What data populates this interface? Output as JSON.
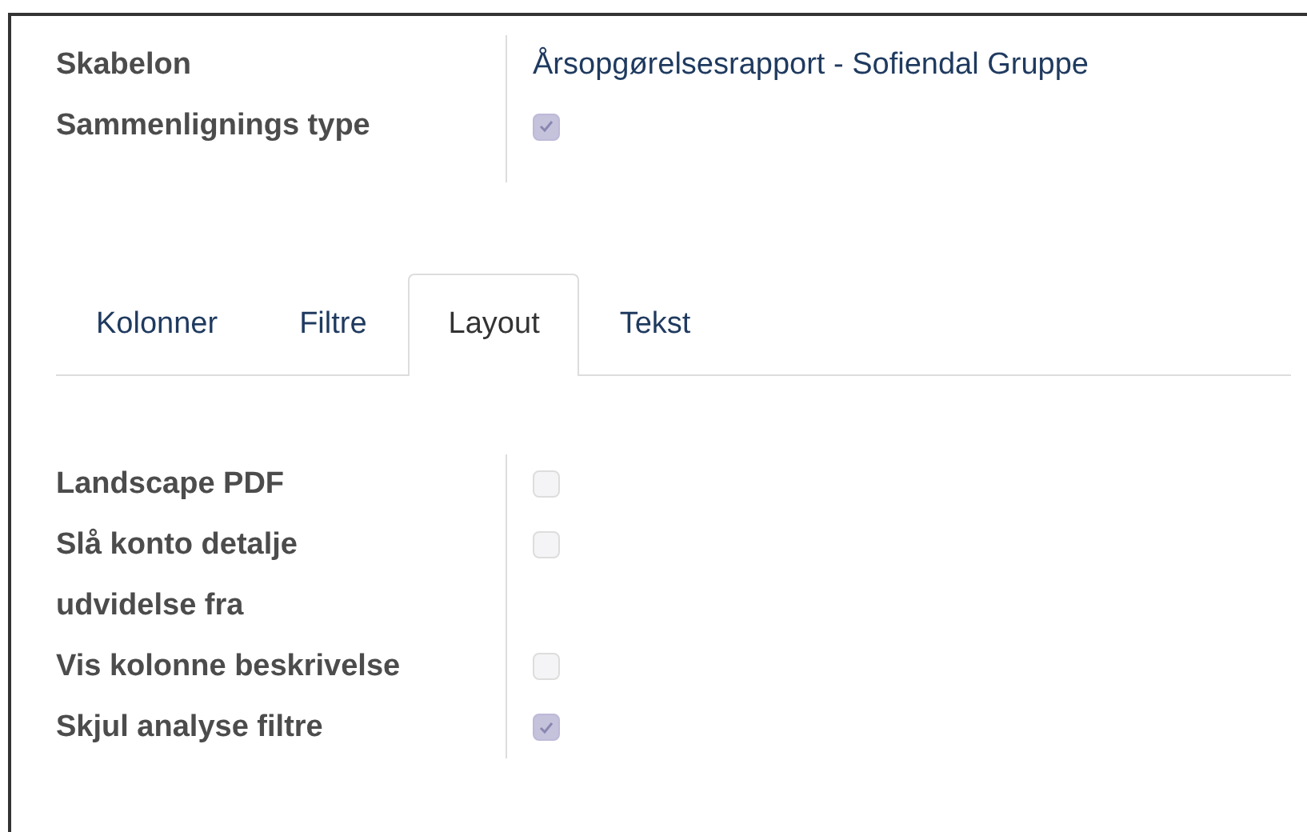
{
  "header_fields": [
    {
      "label": "Skabelon",
      "kind": "text",
      "value": "Årsopgørelsesrapport - Sofiendal Gruppe"
    },
    {
      "label": "Sammenlignings type",
      "kind": "checkbox",
      "checked": true
    }
  ],
  "tabs": [
    {
      "label": "Kolonner",
      "selected": false
    },
    {
      "label": "Filtre",
      "selected": false
    },
    {
      "label": "Layout",
      "selected": true
    },
    {
      "label": "Tekst",
      "selected": false
    }
  ],
  "layout_fields": [
    {
      "label": "Landscape PDF",
      "kind": "checkbox",
      "checked": false
    },
    {
      "label": "Slå konto detalje udvidelse fra",
      "kind": "checkbox",
      "checked": false
    },
    {
      "label": "Vis kolonne beskrivelse",
      "kind": "checkbox",
      "checked": false
    },
    {
      "label": "Skjul analyse filtre",
      "kind": "checkbox",
      "checked": true
    }
  ]
}
